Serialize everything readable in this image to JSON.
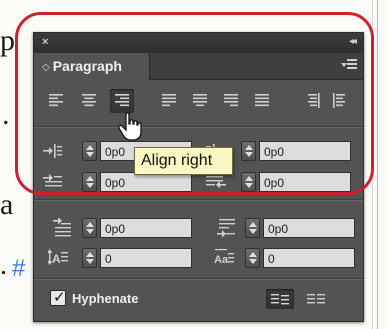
{
  "document": {
    "letters": [
      "p",
      ".",
      "a",
      "."
    ],
    "hash": "#"
  },
  "panel": {
    "close_icon": "×",
    "collapse_icon": "◂◂",
    "tab_arrows": "◇",
    "tab_label": "Paragraph",
    "align_buttons": [
      "align-left",
      "align-center",
      "align-right",
      "justify-last-left",
      "justify-last-center",
      "justify-last-right",
      "justify-all",
      "align-towards-spine",
      "align-away-from-spine"
    ],
    "active_align": "align-right",
    "fields": {
      "left_indent": "0p0",
      "right_indent": "0p0",
      "first_line_indent": "0p0",
      "last_line_indent": "0p0",
      "space_before": "0p0",
      "space_after": "0p0",
      "drop_cap_lines": "0",
      "drop_cap_chars": "0"
    },
    "hyphenate_label": "Hyphenate",
    "hyphenate_checked": true
  },
  "tooltip": {
    "text": "Align right"
  },
  "colors": {
    "highlight": "#d2202a",
    "panel_bg": "#535353",
    "tooltip_bg": "#fbf7c2"
  }
}
